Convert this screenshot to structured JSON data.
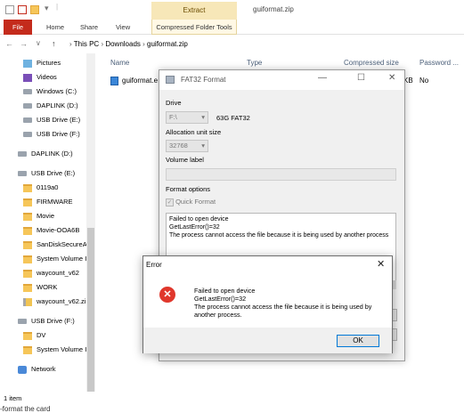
{
  "explorer": {
    "window_title": "guiformat.zip",
    "context_tab": "Extract",
    "ribbon_tabs": [
      "File",
      "Home",
      "Share",
      "View"
    ],
    "context_ribbon_tab": "Compressed Folder Tools",
    "path": [
      "This PC",
      "Downloads",
      "guiformat.zip"
    ],
    "columns": [
      "Name",
      "Type",
      "Compressed size",
      "Password ..."
    ],
    "file": {
      "name": "guiformat.e",
      "size_tail": "KB",
      "password": "No"
    },
    "status": "1 item",
    "behind_text": "-format the card"
  },
  "nav": [
    {
      "label": "Pictures",
      "icon": "pictures-icon"
    },
    {
      "label": "Videos",
      "icon": "videos-icon"
    },
    {
      "label": "Windows (C:)",
      "icon": "drive-icon"
    },
    {
      "label": "DAPLINK (D:)",
      "icon": "drive-icon"
    },
    {
      "label": "USB Drive (E:)",
      "icon": "drive-icon"
    },
    {
      "label": "USB Drive (F:)",
      "icon": "drive-icon"
    },
    {
      "label": "DAPLINK (D:)",
      "icon": "drive-icon"
    },
    {
      "label": "USB Drive (E:)",
      "icon": "drive-icon"
    },
    {
      "label": "0119a0",
      "icon": "folder-icon"
    },
    {
      "label": "FIRMWARE",
      "icon": "folder-icon"
    },
    {
      "label": "Movie",
      "icon": "folder-icon"
    },
    {
      "label": "Movie-OOA6B",
      "icon": "folder-icon"
    },
    {
      "label": "SanDiskSecureA",
      "icon": "folder-icon"
    },
    {
      "label": "System Volume I",
      "icon": "folder-icon"
    },
    {
      "label": "waycount_v62",
      "icon": "folder-icon"
    },
    {
      "label": "WORK",
      "icon": "folder-icon"
    },
    {
      "label": "waycount_v62.zi",
      "icon": "zip-icon"
    },
    {
      "label": "USB Drive (F:)",
      "icon": "drive-icon"
    },
    {
      "label": "DV",
      "icon": "folder-icon"
    },
    {
      "label": "System Volume I",
      "icon": "folder-icon"
    },
    {
      "label": "Network",
      "icon": "network-icon"
    }
  ],
  "fat32": {
    "title": "FAT32 Format",
    "drive_label": "Drive",
    "drive_value": "F:\\",
    "drive_info": "63G FAT32",
    "alloc_label": "Allocation unit size",
    "alloc_value": "32768",
    "volume_label": "Volume label",
    "format_options": "Format options",
    "quick_format": "Quick Format",
    "quick_format_checked": true,
    "log": [
      "Failed to open device",
      "GetLastError()=32",
      "The process cannot access the file because it is being used by another process"
    ]
  },
  "error": {
    "title": "Error",
    "lines": [
      "Failed to open device",
      "GetLastError()=32",
      "The process cannot access the file because it is being used by another process."
    ],
    "ok_label": "OK"
  }
}
